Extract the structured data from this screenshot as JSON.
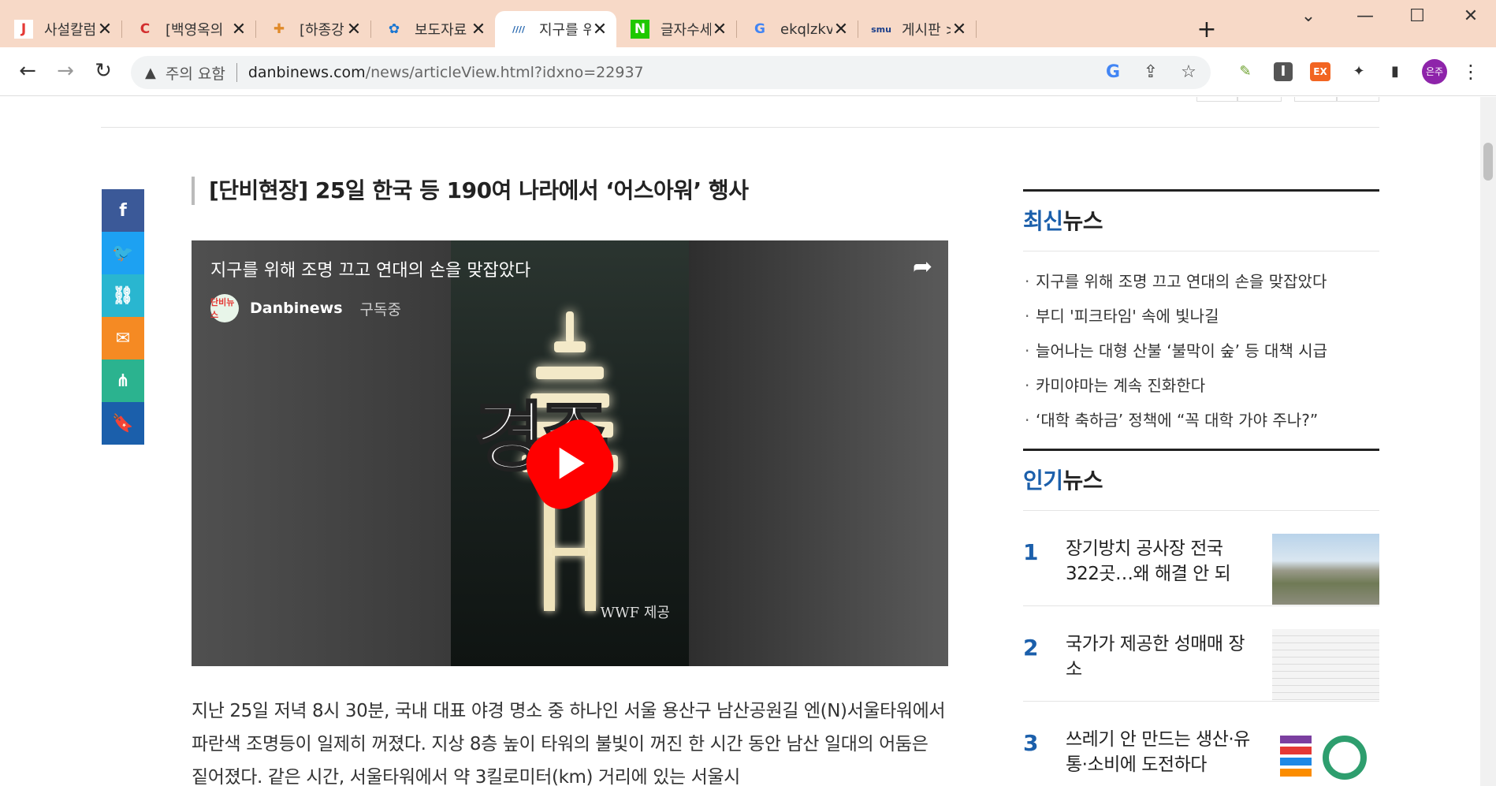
{
  "browser": {
    "tabs": [
      {
        "title": "사설칼럼 |",
        "favicon": "J",
        "fav_color": "#e53935",
        "fav_bg": "#ffffff"
      },
      {
        "title": "[백영옥의",
        "favicon": "C",
        "fav_color": "#d32f2f",
        "fav_bg": "transparent"
      },
      {
        "title": "[하종강 칼",
        "favicon": "✚",
        "fav_color": "#e08a2a",
        "fav_bg": "transparent"
      },
      {
        "title": "보도자료 <",
        "favicon": "✿",
        "fav_color": "#1976d2",
        "fav_bg": "transparent"
      },
      {
        "title": "지구를 위히",
        "favicon": "////",
        "fav_color": "#1b5fab",
        "fav_bg": "transparent"
      },
      {
        "title": "글자수세기",
        "favicon": "N",
        "fav_color": "#ffffff",
        "fav_bg": "#1ec800"
      },
      {
        "title": "ekqlzkvp -",
        "favicon": "G",
        "fav_color": "#4285f4",
        "fav_bg": "transparent"
      },
      {
        "title": "게시판 >디",
        "favicon": "smu",
        "fav_color": "#1a3e8a",
        "fav_bg": "transparent"
      }
    ],
    "active_tab": 4,
    "new_tab": "+",
    "window_controls": {
      "tabsearch": "⌄",
      "minimize": "—",
      "maximize": "☐",
      "close": "✕"
    },
    "nav": {
      "back": "←",
      "forward": "→",
      "reload": "↻"
    },
    "omnibox": {
      "warning_icon": "warning-triangle",
      "warning": "주의 요함",
      "url_host": "danbinews.com",
      "url_path": "/news/articleView.html?idxno=22937"
    },
    "omni_icons": {
      "google": "G",
      "share": "⇪",
      "bookmark": "☆"
    },
    "extensions": {
      "ext1": "✎",
      "ext2": "I",
      "ext3": "EX",
      "puzzle": "✦",
      "sidepanel": "▮",
      "profile": "은주",
      "menu": "⋮"
    }
  },
  "share_bar": [
    {
      "icon": "f",
      "name": "facebook-icon",
      "color": "#3b5998"
    },
    {
      "icon": "🐦",
      "name": "twitter-icon",
      "color": "#1da1f2"
    },
    {
      "icon": "⛓",
      "name": "link-icon",
      "color": "#29b6d0"
    },
    {
      "icon": "✉",
      "name": "mail-icon",
      "color": "#f58a23"
    },
    {
      "icon": "⋔",
      "name": "share-icon",
      "color": "#2bb38f"
    },
    {
      "icon": "🔖",
      "name": "bookmark-icon",
      "color": "#1b5fab"
    }
  ],
  "article": {
    "headline": "[단비현장] 25일 한국 등 190여 나라에서 ‘어스아워’ 행사",
    "video": {
      "title": "지구를 위해 조명 끄고 연대의 손을 맞잡았다",
      "channel": "Danbinews",
      "channel_avatar": "단비뉴스",
      "subscribed": "구독중",
      "overlay_text": "경주",
      "credit": "WWF 제공",
      "share_icon": "➦"
    },
    "body": "지난 25일 저녁 8시 30분, 국내 대표 야경 명소 중 하나인 서울 용산구 남산공원길 엔(N)서울타워에서 파란색 조명등이 일제히 꺼졌다. 지상 8층 높이 타워의 불빛이 꺼진 한 시간 동안 남산 일대의 어둠은 짙어졌다. 같은 시간, 서울타워에서 약 3킬로미터(km) 거리에 있는 서울시"
  },
  "sidebar": {
    "latest": {
      "title_hl": "최신",
      "title_rest": "뉴스",
      "items": [
        "지구를 위해 조명 끄고 연대의 손을 맞잡았다",
        "부디 '피크타임' 속에 빛나길",
        "늘어나는 대형 산불 ‘불막이 숲’ 등 대책 시급",
        "카미야마는 계속 진화한다",
        "‘대학 축하금’ 정책에 “꼭 대학 가야 주나?”"
      ]
    },
    "popular": {
      "title_hl": "인기",
      "title_rest": "뉴스",
      "items": [
        {
          "rank": "1",
          "title": "장기방치 공사장 전국 322곳…왜 해결 안 되"
        },
        {
          "rank": "2",
          "title": "국가가 제공한 성매매 장소"
        },
        {
          "rank": "3",
          "title": "쓰레기 안 만드는 생산·유통·소비에 도전하다"
        }
      ]
    }
  }
}
